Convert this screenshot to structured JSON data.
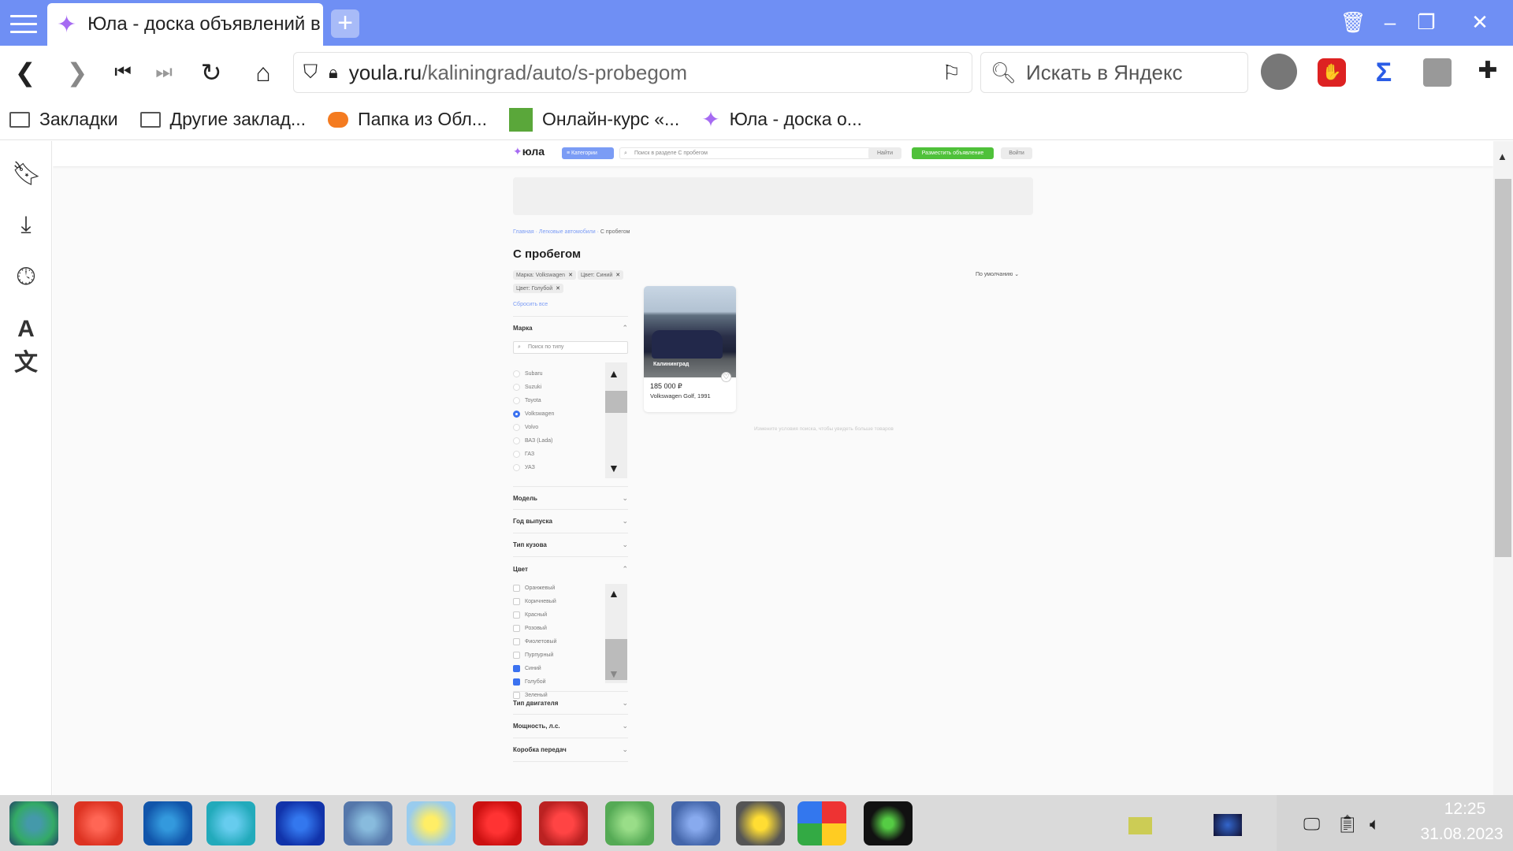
{
  "browser": {
    "tab_title": "Юла - доска объявлений в",
    "url_domain": "youla.ru",
    "url_path": "/kaliningrad/auto/s-probegom",
    "search_placeholder": "Искать в Яндекс"
  },
  "bookmarks": [
    {
      "label": "Закладки",
      "icon": "folder-icon"
    },
    {
      "label": "Другие заклад...",
      "icon": "folder-icon"
    },
    {
      "label": "Папка из Обл...",
      "icon": "cloud-icon"
    },
    {
      "label": "Онлайн-курс «...",
      "icon": "course-icon"
    },
    {
      "label": "Юла - доска о...",
      "icon": "youla-icon"
    }
  ],
  "site": {
    "logo": "юла",
    "categories_label": "Категории",
    "search_placeholder": "Поиск в разделе С пробегом",
    "find_label": "Найти",
    "post_ad_label": "Разместить объявление",
    "login_label": "Войти",
    "breadcrumb": [
      "Главная",
      "Легковые автомобили",
      "С пробегом"
    ],
    "page_title": "С пробегом",
    "sort_label": "По умолчанию",
    "chips": [
      "Марка: Volkswagen",
      "Цвет: Синий",
      "Цвет: Голубой"
    ],
    "reset_label": "Сбросить все",
    "brand_facet": {
      "title": "Марка",
      "search_placeholder": "Поиск по типу",
      "items": [
        {
          "label": "Subaru",
          "selected": false
        },
        {
          "label": "Suzuki",
          "selected": false
        },
        {
          "label": "Toyota",
          "selected": false
        },
        {
          "label": "Volkswagen",
          "selected": true
        },
        {
          "label": "Volvo",
          "selected": false
        },
        {
          "label": "ВАЗ (Lada)",
          "selected": false
        },
        {
          "label": "ГАЗ",
          "selected": false
        },
        {
          "label": "УАЗ",
          "selected": false
        }
      ]
    },
    "collapsed_facets_1": [
      "Модель",
      "Год выпуска",
      "Тип кузова"
    ],
    "color_facet": {
      "title": "Цвет",
      "items": [
        {
          "label": "Оранжевый",
          "checked": false
        },
        {
          "label": "Коричневый",
          "checked": false
        },
        {
          "label": "Красный",
          "checked": false
        },
        {
          "label": "Розовый",
          "checked": false
        },
        {
          "label": "Фиолетовый",
          "checked": false
        },
        {
          "label": "Пурпурный",
          "checked": false
        },
        {
          "label": "Синий",
          "checked": true
        },
        {
          "label": "Голубой",
          "checked": true
        },
        {
          "label": "Зеленый",
          "checked": false
        }
      ]
    },
    "collapsed_facets_2": [
      "Тип двигателя",
      "Мощность, л.с.",
      "Коробка передач"
    ],
    "listing": {
      "city": "Калининград",
      "price": "185 000 ₽",
      "title": "Volkswagen Golf, 1991"
    },
    "hint": "Измените условия поиска, чтобы увидеть больше товаров"
  },
  "clock": {
    "time": "12:25",
    "date": "31.08.2023"
  },
  "colors": {
    "titlebar": "#6f8ff4",
    "accent_blue": "#3b72f0",
    "post_green": "#4fc13a"
  }
}
